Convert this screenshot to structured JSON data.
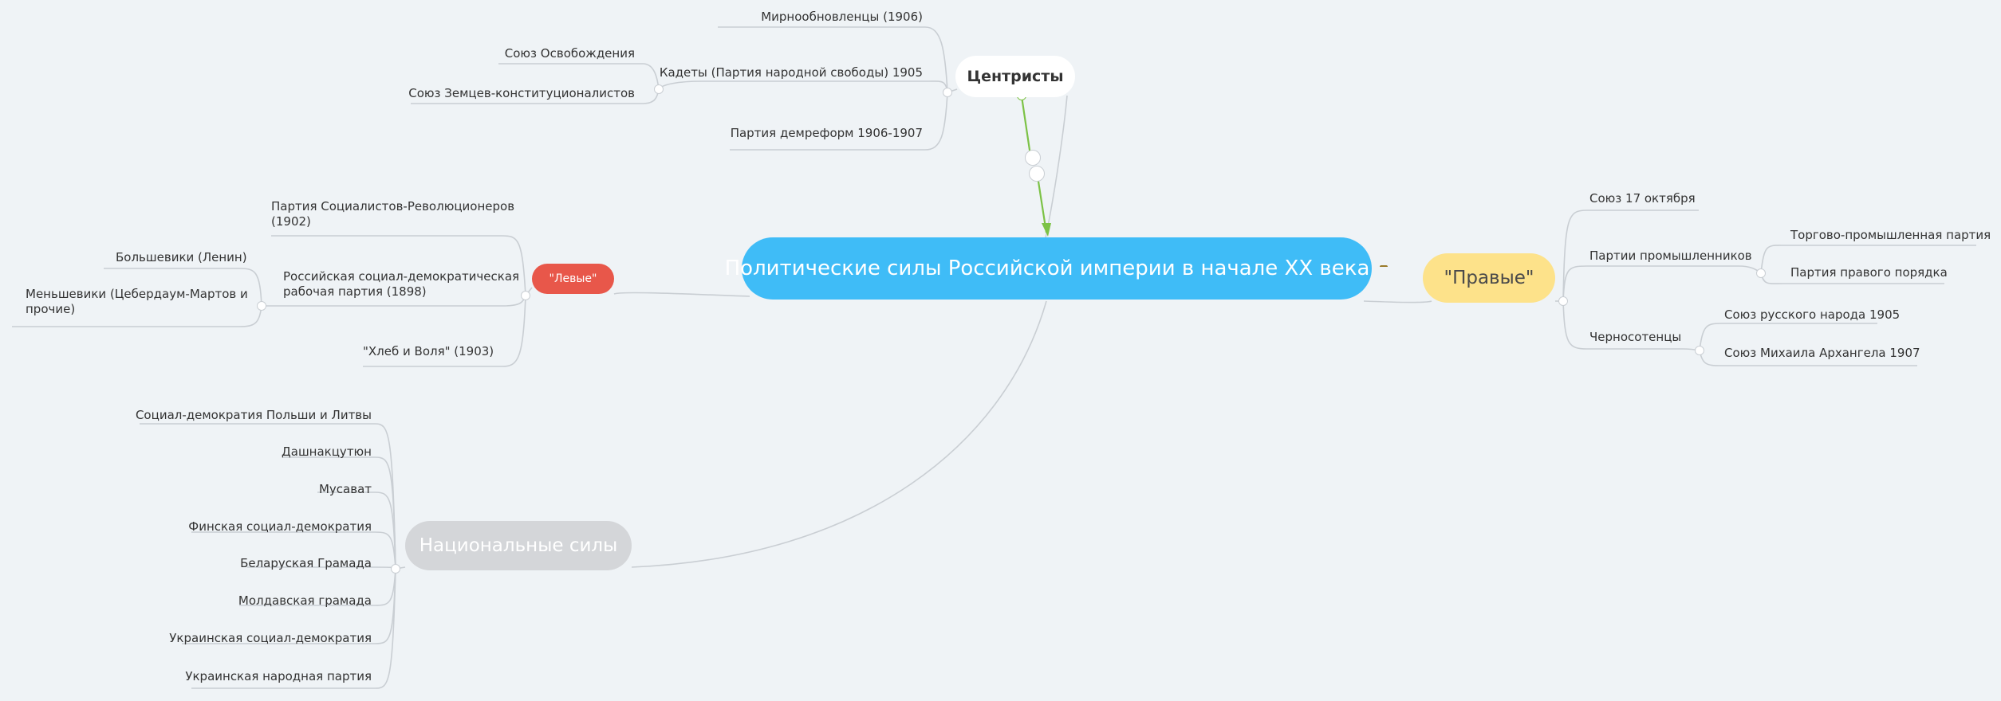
{
  "root": {
    "title": "Политические силы Российской империи в начале XX века",
    "icon": "emoji-icon"
  },
  "centrists": {
    "label": "Центристы",
    "items": [
      {
        "label": "Мирнообновленцы (1906)"
      },
      {
        "label": "Кадеты (Партия народной свободы) 1905",
        "children": [
          {
            "label": "Союз Освобождения"
          },
          {
            "label": "Союз Земцев-конституционалистов"
          }
        ]
      },
      {
        "label": "Партия демреформ 1906-1907"
      }
    ]
  },
  "left": {
    "label": "\"Левые\"",
    "items": [
      {
        "label": "Партия Социалистов-Революционеров (1902)"
      },
      {
        "label": "Российская социал-демократическая рабочая партия (1898)",
        "children": [
          {
            "label": "Большевики (Ленин)"
          },
          {
            "label": "Меньшевики (Цебердаум-Мартов и прочие)"
          }
        ]
      },
      {
        "label": "\"Хлеб и Воля\" (1903)"
      }
    ]
  },
  "right": {
    "label": "\"Правые\"",
    "items": [
      {
        "label": "Союз 17 октября"
      },
      {
        "label": "Партии промышленников",
        "children": [
          {
            "label": "Торгово-промышленная партия"
          },
          {
            "label": "Партия правого порядка"
          }
        ]
      },
      {
        "label": "Черносотенцы",
        "children": [
          {
            "label": "Союз русского народа 1905"
          },
          {
            "label": "Союз Михаила Архангела 1907"
          }
        ]
      }
    ]
  },
  "national": {
    "label": "Национальные силы",
    "items": [
      {
        "label": "Социал-демократия Польши и Литвы"
      },
      {
        "label": "Дашнакцутюн"
      },
      {
        "label": "Мусават"
      },
      {
        "label": "Финская социал-демократия"
      },
      {
        "label": "Беларуская Грамада"
      },
      {
        "label": "Молдавская грамада"
      },
      {
        "label": "Украинская социал-демократия"
      },
      {
        "label": "Украинская народная партия"
      }
    ]
  },
  "colors": {
    "root": "#3fbcf7",
    "left": "#e8574a",
    "right": "#fde28a",
    "national": "#d4d6d9",
    "centrists": "#ffffff",
    "arrow": "#7cc246",
    "line": "#c9ced3",
    "background": "#eff3f6"
  }
}
